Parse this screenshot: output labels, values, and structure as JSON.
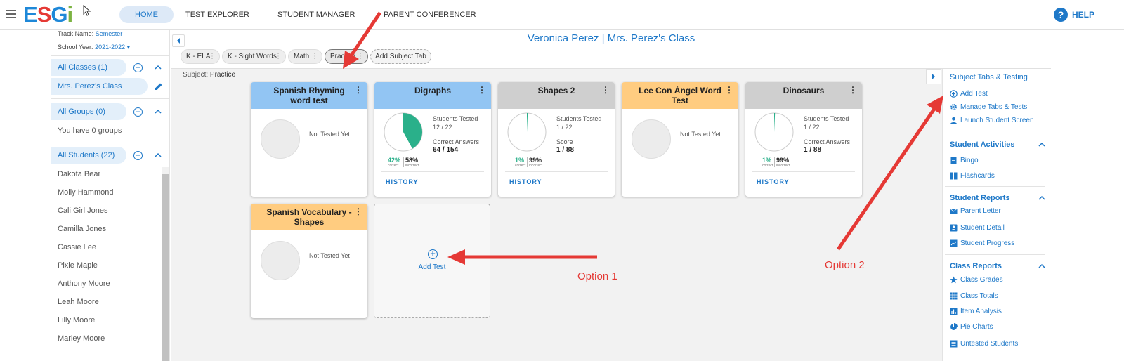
{
  "topbar": {
    "logo": {
      "e": "E",
      "s": "S",
      "g": "G",
      "i": "i"
    },
    "nav": [
      "HOME",
      "TEST EXPLORER",
      "STUDENT MANAGER",
      "PARENT CONFERENCER"
    ],
    "help": "HELP",
    "help_glyph": "?"
  },
  "leftbar": {
    "track_label": "Track Name:",
    "track_value": "Semester",
    "year_label": "School Year:",
    "year_value": "2021-2022",
    "classes_header": "All Classes (1)",
    "class_item": "Mrs. Perez's Class",
    "groups_header": "All Groups (0)",
    "groups_empty": "You have 0 groups",
    "students_header": "All Students (22)",
    "students": [
      "Dakota Bear",
      "Molly Hammond",
      "Cali Girl Jones",
      "Camilla Jones",
      "Cassie Lee",
      "Pixie Maple",
      "Anthony Moore",
      "Leah Moore",
      "Lilly Moore",
      "Marley Moore"
    ]
  },
  "main": {
    "class_title": "Veronica Perez | Mrs. Perez's Class",
    "subject_tabs": [
      "K - ELA",
      "K - Sight Words",
      "Math",
      "Practice"
    ],
    "add_subject_tab": "Add Subject Tab",
    "subject_label": "Subject:",
    "subject_value": "Practice"
  },
  "cards": [
    {
      "title": "Spanish Rhyming word test",
      "status": "Not Tested Yet",
      "color": "#92c5f3"
    },
    {
      "title": "Digraphs",
      "color": "#92c5f3",
      "students_label": "Students Tested",
      "students_value": "12 / 22",
      "metric_label": "Correct Answers",
      "metric_value": "64 / 154",
      "correct_pct": "42%",
      "correct_word": "correct",
      "incorrect_pct": "58%",
      "incorrect_word": "incorrect",
      "history": "HISTORY",
      "correct_fraction": 0.42
    },
    {
      "title": "Shapes 2",
      "color": "#cfcfcf",
      "students_label": "Students Tested",
      "students_value": "1 / 22",
      "metric_label": "Score",
      "metric_value": "1 / 88",
      "correct_pct": "1%",
      "correct_word": "correct",
      "incorrect_pct": "99%",
      "incorrect_word": "incorrect",
      "history": "HISTORY",
      "correct_fraction": 0.01
    },
    {
      "title": "Lee Con Ángel Word Test",
      "status": "Not Tested Yet",
      "color": "#ffcc80"
    },
    {
      "title": "Dinosaurs",
      "color": "#cfcfcf",
      "students_label": "Students Tested",
      "students_value": "1 / 22",
      "metric_label": "Correct Answers",
      "metric_value": "1 / 88",
      "correct_pct": "1%",
      "correct_word": "correct",
      "incorrect_pct": "99%",
      "incorrect_word": "incorrect",
      "history": "HISTORY",
      "correct_fraction": 0.01
    },
    {
      "title": "Spanish Vocabulary - Shapes",
      "status": "Not Tested Yet",
      "color": "#ffcc80"
    }
  ],
  "add_test": "Add Test",
  "annotations": {
    "option1": "Option 1",
    "option2": "Option 2"
  },
  "rightpanel": {
    "title": "Subject Tabs & Testing",
    "testing_items": [
      "Add Test",
      "Manage Tabs & Tests",
      "Launch Student Screen"
    ],
    "activities_header": "Student Activities",
    "activities": [
      "Bingo",
      "Flashcards"
    ],
    "reports_header": "Student Reports",
    "reports": [
      "Parent Letter",
      "Student Detail",
      "Student Progress"
    ],
    "class_reports_header": "Class Reports",
    "class_reports": [
      "Class Grades",
      "Class Totals",
      "Item Analysis",
      "Pie Charts",
      "Untested Students"
    ]
  },
  "colors": {
    "accent": "#1e78c8",
    "correct": "#2ab08a",
    "annotation": "#e53935"
  },
  "icons": [
    "menu-icon",
    "cursor-icon",
    "help-icon",
    "plus-circle-icon",
    "chevron-up-icon",
    "pencil-icon",
    "chevron-left-icon",
    "chevron-right-icon",
    "gear-icon",
    "person-icon",
    "document-icon",
    "grid-icon",
    "envelope-icon",
    "id-card-icon",
    "trend-chart-icon",
    "star-icon",
    "table-icon",
    "bar-chart-icon",
    "pie-chart-icon",
    "list-icon",
    "kebab-icon"
  ]
}
